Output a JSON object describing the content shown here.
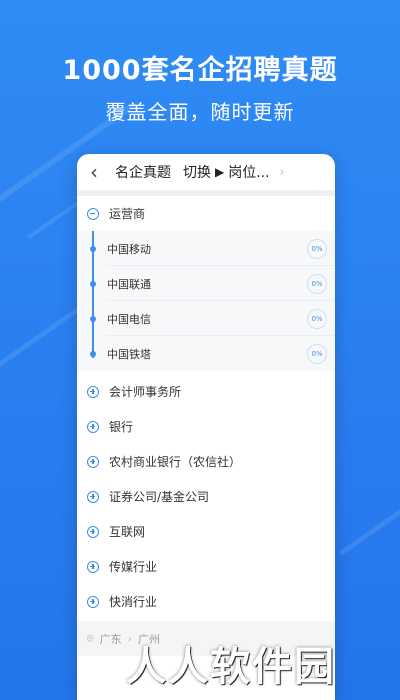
{
  "promo": {
    "title": "1000套名企招聘真题",
    "subtitle": "覆盖全面，随时更新"
  },
  "topbar": {
    "back_icon": "chevron-left-icon",
    "title": "名企真题",
    "switch_label": "切换",
    "switch_icon": "play-triangle-icon",
    "position_label": "岗位..."
  },
  "categories": [
    {
      "label": "运营商",
      "expanded": true
    },
    {
      "label": "会计师事务所",
      "expanded": false
    },
    {
      "label": "银行",
      "expanded": false
    },
    {
      "label": "农村商业银行（农信社）",
      "expanded": false
    },
    {
      "label": "证券公司/基金公司",
      "expanded": false
    },
    {
      "label": "互联网",
      "expanded": false
    },
    {
      "label": "传媒行业",
      "expanded": false
    },
    {
      "label": "快消行业",
      "expanded": false
    }
  ],
  "subitems": [
    {
      "label": "中国移动",
      "progress": "0%"
    },
    {
      "label": "中国联通",
      "progress": "0%"
    },
    {
      "label": "中国电信",
      "progress": "0%"
    },
    {
      "label": "中国铁塔",
      "progress": "0%"
    }
  ],
  "location": {
    "province": "广东",
    "city": "广州"
  },
  "watermark": "人人软件园",
  "colors": {
    "background": "#2a7ef0",
    "accent": "#3d8ef0"
  }
}
